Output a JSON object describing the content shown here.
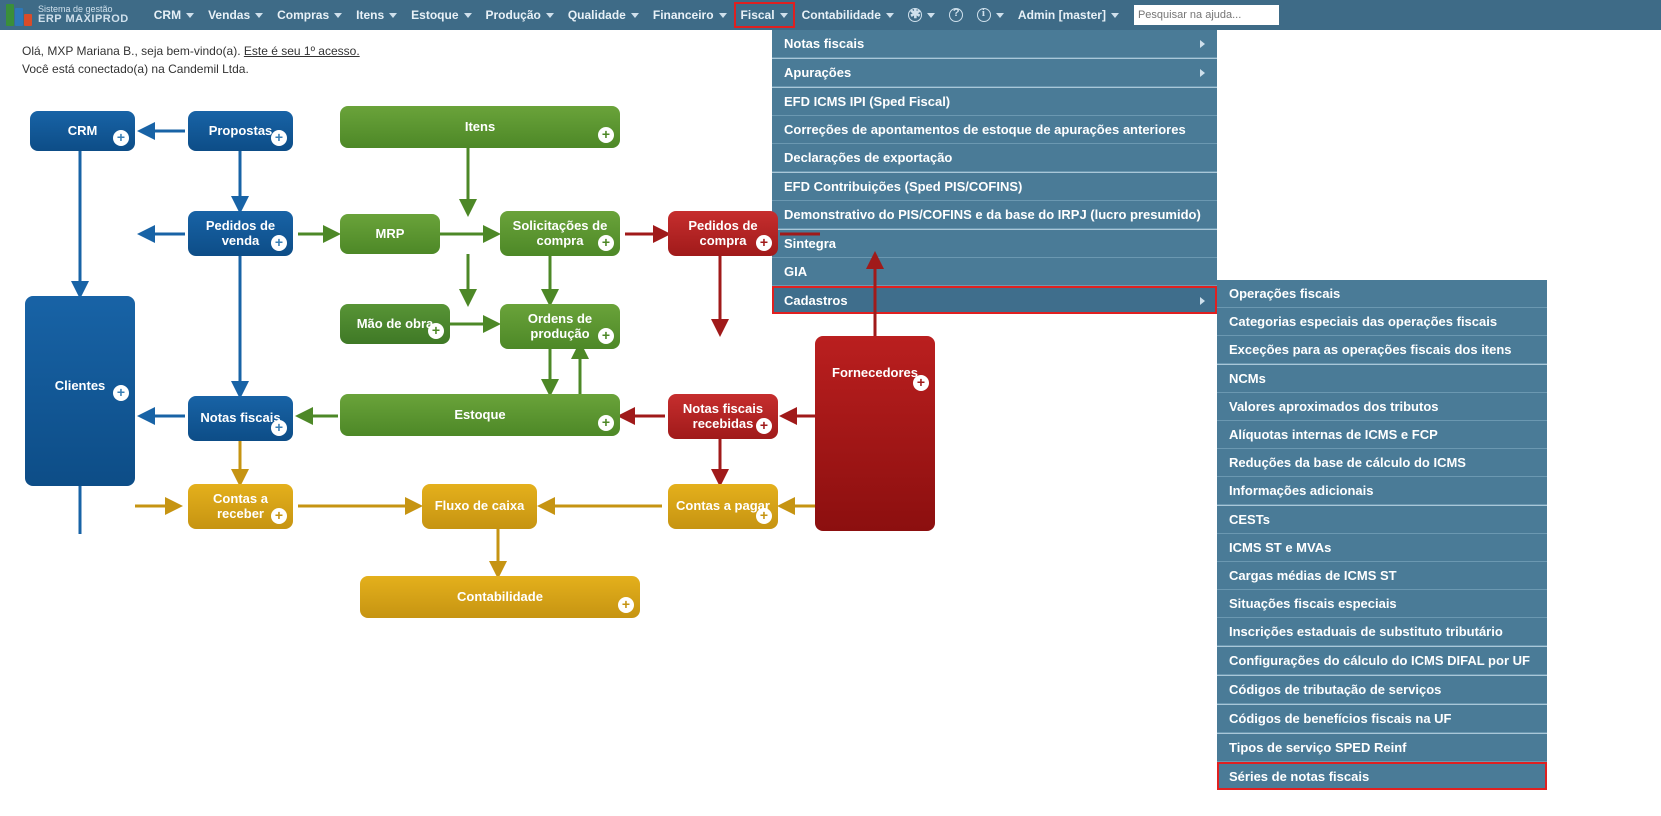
{
  "app": {
    "line1": "Sistema de gestão",
    "line2": "ERP MAXIPROD"
  },
  "nav": {
    "crm": "CRM",
    "vendas": "Vendas",
    "compras": "Compras",
    "itens": "Itens",
    "estoque": "Estoque",
    "producao": "Produção",
    "qualidade": "Qualidade",
    "financeiro": "Financeiro",
    "fiscal": "Fiscal",
    "contabilidade": "Contabilidade",
    "admin": "Admin [master]"
  },
  "search": {
    "placeholder": "Pesquisar na ajuda..."
  },
  "welcome": {
    "hello": "Olá, MXP Mariana B., seja bem-vindo(a). ",
    "first": "Este é seu 1º acesso.",
    "connected": "Você está conectado(a) na Candemil Ltda."
  },
  "fiscalMenu": {
    "notas": "Notas fiscais",
    "apuracoes": "Apurações",
    "efd": "EFD ICMS IPI (Sped Fiscal)",
    "correcoes": "Correções de apontamentos de estoque de apurações anteriores",
    "decl": "Declarações de exportação",
    "efdcontrib": "EFD Contribuições (Sped PIS/COFINS)",
    "demonstrativo": "Demonstrativo do PIS/COFINS e da base do IRPJ (lucro presumido)",
    "sintegra": "Sintegra",
    "gia": "GIA",
    "cadastros": "Cadastros"
  },
  "cadastrosMenu": {
    "m0": "Operações fiscais",
    "m1": "Categorias especiais das operações fiscais",
    "m2": "Exceções para as operações fiscais dos itens",
    "m3": "NCMs",
    "m4": "Valores aproximados dos tributos",
    "m5": "Alíquotas internas de ICMS e FCP",
    "m6": "Reduções da base de cálculo do ICMS",
    "m7": "Informações adicionais",
    "m8": "CESTs",
    "m9": "ICMS ST e MVAs",
    "m10": "Cargas médias de ICMS ST",
    "m11": "Situações fiscais especiais",
    "m12": "Inscrições estaduais de substituto tributário",
    "m13": "Configurações do cálculo do ICMS DIFAL por UF",
    "m14": "Códigos de tributação de serviços",
    "m15": "Códigos de benefícios fiscais na UF",
    "m16": "Tipos de serviço SPED Reinf",
    "m17": "Séries de notas fiscais"
  },
  "diagram": {
    "crm": "CRM",
    "propostas": "Propostas",
    "itens": "Itens",
    "pedidosVenda": "Pedidos de venda",
    "mrp": "MRP",
    "solicCompra": "Solicitações de compra",
    "pedidosCompra": "Pedidos de compra",
    "clientes": "Clientes",
    "maoObra": "Mão de obra",
    "ordensProd": "Ordens de produção",
    "fornecedores": "Fornecedores",
    "notasFiscais": "Notas fiscais",
    "estoque": "Estoque",
    "nfRecebidas": "Notas fiscais recebidas",
    "contasReceber": "Contas a receber",
    "fluxoCaixa": "Fluxo de caixa",
    "contasPagar": "Contas a pagar",
    "contabilidade": "Contabilidade"
  }
}
